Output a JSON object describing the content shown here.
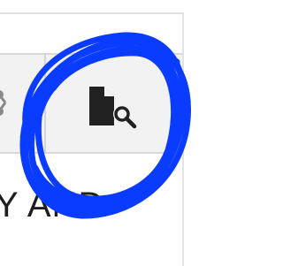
{
  "toolbar": {
    "left_icon": "share-icon",
    "active_icon": "document-search-icon"
  },
  "content": {
    "heading_fragment": "Y AND"
  },
  "annotation": {
    "marker_color": "#0a3cff"
  }
}
